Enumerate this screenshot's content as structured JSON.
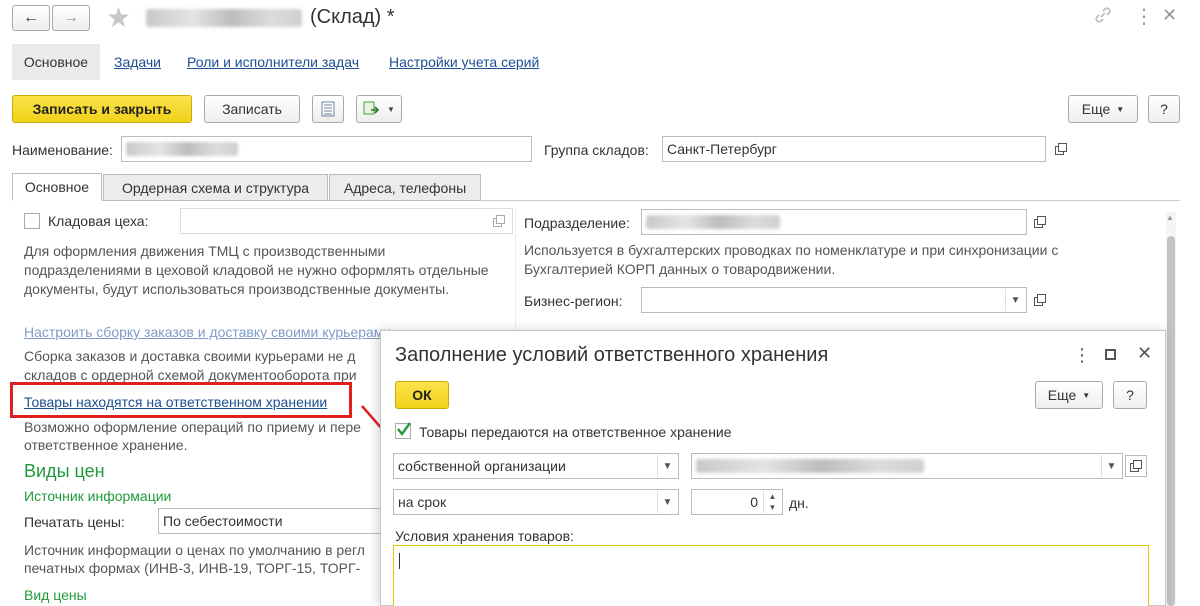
{
  "titlebar": {
    "title": "(Склад) *",
    "back_glyph": "←",
    "fwd_glyph": "→",
    "star_glyph": "★",
    "link_glyph": "🔗",
    "menu_glyph": "⋮",
    "close_glyph": "✕"
  },
  "nav": {
    "tabs": [
      "Основное",
      "Задачи",
      "Роли и исполнители задач",
      "Настройки учета серий"
    ]
  },
  "toolbar": {
    "save_close": "Записать и закрыть",
    "save": "Записать",
    "more": "Еще",
    "help": "?"
  },
  "header": {
    "name_label": "Наименование:",
    "group_label": "Группа складов:",
    "group_value": "Санкт-Петербург"
  },
  "tabs": [
    "Основное",
    "Ордерная схема и структура",
    "Адреса, телефоны"
  ],
  "left": {
    "workshop_label": "Кладовая цеха:",
    "workshop_desc": "Для оформления движения ТМЦ с производственными подразделениями в цеховой кладовой не нужно оформлять отдельные документы, будут использоваться производственные документы.",
    "courier_link": "Настроить сборку заказов и доставку своими курьерами",
    "courier_desc_1": "Сборка заказов и доставка своими курьерами не д",
    "courier_desc_2": "складов с ордерной схемой документооборота при",
    "custody_link": "Товары находятся на ответственном хранении",
    "custody_desc_1": "Возможно оформление операций по приему и пере",
    "custody_desc_2": "ответственное хранение.",
    "prices_header": "Виды цен",
    "source_header": "Источник информации",
    "print_label": "Печатать цены:",
    "print_value": "По себестоимости",
    "source_desc_1": "Источник информации о ценах по умолчанию в регл",
    "source_desc_2": "печатных формах (ИНВ-3, ИНВ-19, ТОРГ-15, ТОРГ-",
    "price_type_header": "Вид цены"
  },
  "right": {
    "dept_label": "Подразделение:",
    "dept_desc": "Используется в бухгалтерских проводках по номенклатуре и при синхронизации с Бухгалтерией КОРП данных о товародвижении.",
    "region_label": "Бизнес-регион:"
  },
  "dialog": {
    "title": "Заполнение условий ответственного хранения",
    "ok": "ОК",
    "more": "Еще",
    "help": "?",
    "checkbox_label": "Товары передаются на ответственное хранение",
    "owner_type": "собственной организации",
    "term_type": "на срок",
    "days_value": "0",
    "days_unit": "дн.",
    "conditions_label": "Условия хранения товаров:"
  },
  "colors": {
    "accent_yellow": "#f4d81f",
    "highlight_red": "#e02020",
    "link_blue": "#1d4f91",
    "green": "#1f9a3b"
  }
}
